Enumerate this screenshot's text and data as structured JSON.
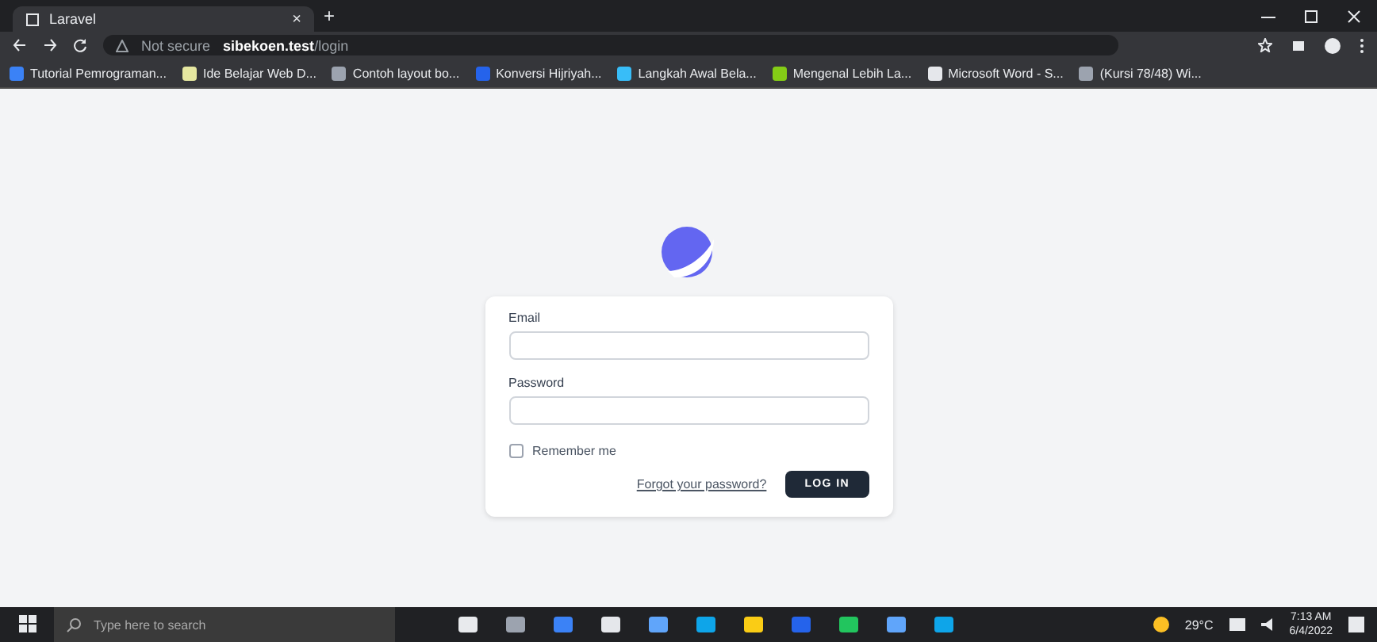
{
  "browser": {
    "tab_title": "Laravel",
    "tab_close": "×",
    "new_tab": "+",
    "security": "Not secure",
    "url_host": "sibekoen.test",
    "url_path": "/login",
    "bookmarks": [
      {
        "label": "Tutorial Pemrograman...",
        "color": "#3b82f6"
      },
      {
        "label": "Ide Belajar Web D...",
        "color": "#e5e7a0"
      },
      {
        "label": "Contoh layout bo...",
        "color": "#9ca3af"
      },
      {
        "label": "Konversi Hijriyah...",
        "color": "#2563eb"
      },
      {
        "label": "Langkah Awal Bela...",
        "color": "#38bdf8"
      },
      {
        "label": "Mengenal Lebih La...",
        "color": "#84cc16"
      },
      {
        "label": "Microsoft Word - S...",
        "color": "#e5e7eb"
      },
      {
        "label": "(Kursi 78/48) Wi...",
        "color": "#9ca3af"
      }
    ]
  },
  "login": {
    "email_label": "Email",
    "password_label": "Password",
    "remember_label": "Remember me",
    "remember_checked": false,
    "forgot_link": "Forgot your password?",
    "submit": "LOG IN"
  },
  "taskbar": {
    "search_placeholder": "Type here to search",
    "weather": "29°C",
    "time": "7:13 AM",
    "date": "6/4/2022"
  }
}
